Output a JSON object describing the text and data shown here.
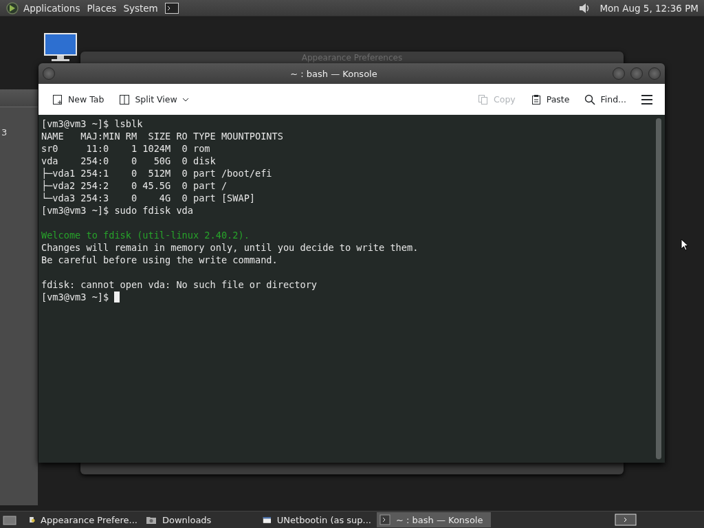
{
  "top_panel": {
    "menus": [
      "Applications",
      "Places",
      "System"
    ],
    "clock": "Mon Aug  5, 12:36 PM"
  },
  "background_windows": [
    {
      "title": "Appearance Preferences"
    },
    {
      "text": "3"
    }
  ],
  "konsole": {
    "title": "~ : bash — Konsole",
    "toolbar": [
      {
        "kind": "newtab",
        "label": "New Tab",
        "disabled": false
      },
      {
        "kind": "split",
        "label": "Split View",
        "disabled": false
      },
      {
        "kind": "copy",
        "label": "Copy",
        "disabled": true
      },
      {
        "kind": "paste",
        "label": "Paste",
        "disabled": false
      },
      {
        "kind": "find",
        "label": "Find...",
        "disabled": false
      },
      {
        "kind": "menu",
        "disabled": false
      }
    ],
    "lines": [
      {
        "kind": "normal",
        "text": "[vm3@vm3 ~]$ lsblk"
      },
      {
        "kind": "normal",
        "text": "NAME   MAJ:MIN RM  SIZE RO TYPE MOUNTPOINTS"
      },
      {
        "kind": "normal",
        "text": "sr0     11:0    1 1024M  0 rom"
      },
      {
        "kind": "normal",
        "text": "vda    254:0    0   50G  0 disk"
      },
      {
        "kind": "normal",
        "text": "├─vda1 254:1    0  512M  0 part /boot/efi"
      },
      {
        "kind": "normal",
        "text": "├─vda2 254:2    0 45.5G  0 part /"
      },
      {
        "kind": "normal",
        "text": "└─vda3 254:3    0    4G  0 part [SWAP]"
      },
      {
        "kind": "normal",
        "text": "[vm3@vm3 ~]$ sudo fdisk vda"
      },
      {
        "kind": "blank"
      },
      {
        "kind": "welcome",
        "text": "Welcome to fdisk (util-linux 2.40.2)."
      },
      {
        "kind": "normal",
        "text": "Changes will remain in memory only, until you decide to write them."
      },
      {
        "kind": "normal",
        "text": "Be careful before using the write command."
      },
      {
        "kind": "blank"
      },
      {
        "kind": "normal",
        "text": "fdisk: cannot open vda: No such file or directory"
      }
    ],
    "prompt": "[vm3@vm3 ~]$ "
  },
  "taskbar": [
    {
      "kind": "prefs",
      "label": "Appearance Prefere...",
      "selected": false
    },
    {
      "kind": "folder",
      "label": "Downloads",
      "selected": false
    },
    {
      "kind": "window",
      "label": "UNetbootin (as sup...",
      "selected": false
    },
    {
      "kind": "terminal",
      "label": "~ : bash — Konsole",
      "selected": true
    }
  ]
}
